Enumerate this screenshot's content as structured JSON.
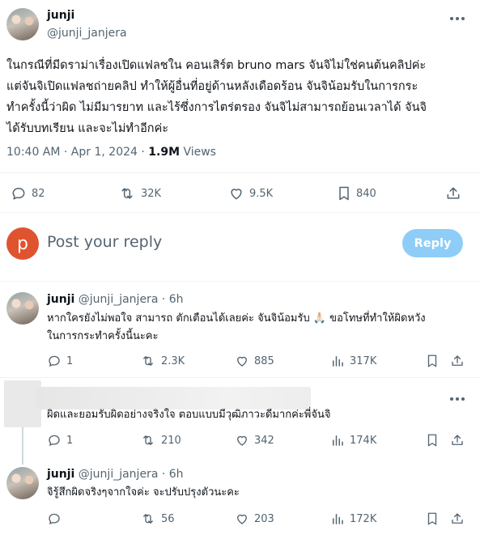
{
  "tweet": {
    "author_name": "junji",
    "author_handle": "@junji_janjera",
    "text_line1": "ในกรณีที่มีดราม่าเรื่องเปิดแฟลชใน คอนเสิร์ต bruno mars จันจิไม่ใช่คนต้นคลิปค่ะ",
    "text_line2": "แต่จันจิเปิดแฟลชถ่ายคลิป ทำให้ผู้อื่นที่อยู่ด้านหลังเดือดร้อน จันจิน้อมรับในการกระ",
    "text_line3": "ทำครั้งนี้ว่าผิด ไม่มีมารยาท และไร้ซึ่งการไตร่ตรอง จันจิไม่สามารถย้อนเวลาได้ จันจิ",
    "text_line4": "ได้รับบทเรียน และจะไม่ทำอีกค่ะ",
    "time": "10:40 AM · Apr 1, 2024 · ",
    "views_count": "1.9M",
    "views_label": "Views",
    "replies": "82",
    "reposts": "32K",
    "likes": "9.5K",
    "bookmarks": "840"
  },
  "compose": {
    "avatar_letter": "p",
    "avatar_color": "#e0532f",
    "placeholder": "Post your reply",
    "button_label": "Reply",
    "button_color": "#8ecdf8"
  },
  "replies": [
    {
      "name": "junji",
      "handle": "@junji_janjera · 6h",
      "line1": "หากใครยังไม่พอใจ สามารถ ตักเตือนได้เลยค่ะ จันจิน้อมรับ 🙏🏻 ขอโทษที่ทำให้ผิดหวัง",
      "line2": "ในการกระทำครั้งนี้นะคะ",
      "replies": "1",
      "reposts": "2.3K",
      "likes": "885",
      "views": "317K"
    },
    {
      "line1": "ผิดและยอมรับผิดอย่างจริงใจ ตอบแบบมีวุฒิภาวะดีมากค่ะพี่จันจิ",
      "replies": "1",
      "reposts": "210",
      "likes": "342",
      "views": "174K"
    },
    {
      "name": "junji",
      "handle": "@junji_janjera · 6h",
      "line1": "จิรู้สึกผิดจริงๆจากใจค่ะ จะปรับปรุงตัวนะคะ",
      "replies": "",
      "reposts": "56",
      "likes": "203",
      "views": "172K"
    }
  ]
}
